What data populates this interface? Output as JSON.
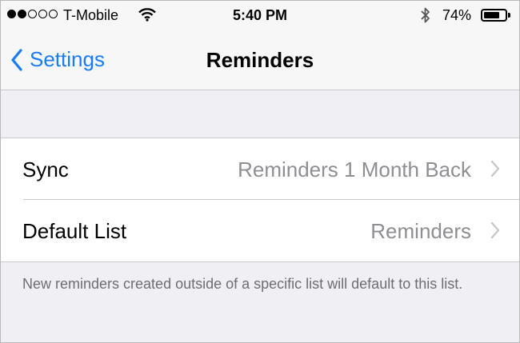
{
  "status_bar": {
    "signal_dots_filled": 2,
    "signal_dots_total": 5,
    "carrier": "T-Mobile",
    "time": "5:40 PM",
    "battery_percent_label": "74%",
    "battery_level": 0.74
  },
  "nav": {
    "back_label": "Settings",
    "title": "Reminders"
  },
  "rows": [
    {
      "label": "Sync",
      "value": "Reminders 1 Month Back"
    },
    {
      "label": "Default List",
      "value": "Reminders"
    }
  ],
  "footer_text": "New reminders created outside of a specific list will default to this list.",
  "colors": {
    "accent": "#1a7cf6",
    "background": "#efeff4",
    "secondary_text": "#8e8e93"
  }
}
